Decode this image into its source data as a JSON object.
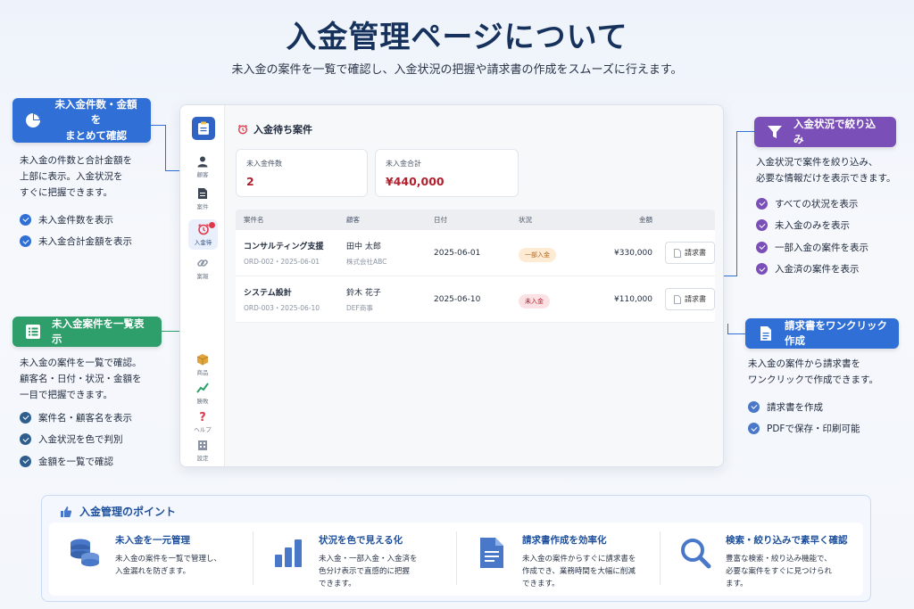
{
  "header": {
    "title": "入金管理ページについて",
    "subtitle": "未入金の案件を一覧で確認し、入金状況の把握や請求書の作成をスムーズに行えます。"
  },
  "colors": {
    "blue": "#2f6fd6",
    "green": "#2e9e6a",
    "purple": "#7b4fb8",
    "navy": "#16325c"
  },
  "callouts": {
    "summary": {
      "icon": "pie-chart-icon",
      "title": "未入金件数・金額を\nまとめて確認",
      "desc": "未入金の件数と合計金額を\n上部に表示。入金状況を\nすぐに把握できます。",
      "checks": [
        "未入金件数を表示",
        "未入金合計金額を表示"
      ]
    },
    "list": {
      "icon": "list-icon",
      "title": "未入金案件を一覧表示",
      "desc": "未入金の案件を一覧で確認。\n顧客名・日付・状況・金額を\n一目で把握できます。",
      "checks": [
        "案件名・顧客名を表示",
        "入金状況を色で判別",
        "金額を一覧で確認"
      ]
    },
    "filter": {
      "icon": "funnel-icon",
      "title": "入金状況で絞り込み",
      "desc": "入金状況で案件を絞り込み、\n必要な情報だけを表示できます。",
      "checks": [
        "すべての状況を表示",
        "未入金のみを表示",
        "一部入金の案件を表示",
        "入金済の案件を表示"
      ]
    },
    "invoice": {
      "icon": "document-icon",
      "title": "請求書をワンクリック作成",
      "desc": "未入金の案件から請求書を\nワンクリックで作成できます。",
      "checks": [
        "請求書を作成",
        "PDFで保存・印刷可能"
      ]
    }
  },
  "app": {
    "rail": [
      {
        "icon": "person-icon",
        "label": "顧客"
      },
      {
        "icon": "document-icon",
        "label": "案件"
      },
      {
        "icon": "alarm-clock-icon",
        "label": "入金待"
      },
      {
        "icon": "link-icon",
        "label": "案報"
      },
      {
        "icon": "box-icon",
        "label": "商品"
      },
      {
        "icon": "chart-line-icon",
        "label": "勝敗"
      },
      {
        "icon": "question-icon",
        "label": "ヘルプ"
      },
      {
        "icon": "building-icon",
        "label": "設定"
      }
    ],
    "page_title": "入金待ち案件",
    "stats": [
      {
        "label": "未入金件数",
        "value": "2"
      },
      {
        "label": "未入金合計",
        "value": "¥440,000"
      }
    ],
    "columns": [
      "案件名",
      "顧客",
      "日付",
      "状況",
      "金額",
      ""
    ],
    "rows": [
      {
        "name": "コンサルティング支援",
        "id": "ORD-002・2025-06-01",
        "customer": "田中 太郎",
        "company": "株式会社ABC",
        "date": "2025-06-01",
        "status": "一部入金",
        "amount": "¥330,000",
        "action": "請求書"
      },
      {
        "name": "システム設計",
        "id": "ORD-003・2025-06-10",
        "customer": "鈴木 花子",
        "company": "DEF商事",
        "date": "2025-06-10",
        "status": "未入金",
        "amount": "¥110,000",
        "action": "請求書"
      }
    ]
  },
  "points": {
    "title": "入金管理のポイント",
    "items": [
      {
        "icon": "coins-icon",
        "title": "未入金を一元管理",
        "desc": "未入金の案件を一覧で管理し、\n入金漏れを防ぎます。"
      },
      {
        "icon": "bar-chart-icon",
        "title": "状況を色で見える化",
        "desc": "未入金・一部入金・入金済を\n色分け表示で直感的に把握\nできます。"
      },
      {
        "icon": "document-icon",
        "title": "請求書作成を効率化",
        "desc": "未入金の案件からすぐに請求書を\n作成でき、業務時間を大幅に削減\nできます。"
      },
      {
        "icon": "search-icon",
        "title": "検索・絞り込みで素早く確認",
        "desc": "豊富な検索・絞り込み機能で、\n必要な案件をすぐに見つけられ\nます。"
      }
    ]
  }
}
